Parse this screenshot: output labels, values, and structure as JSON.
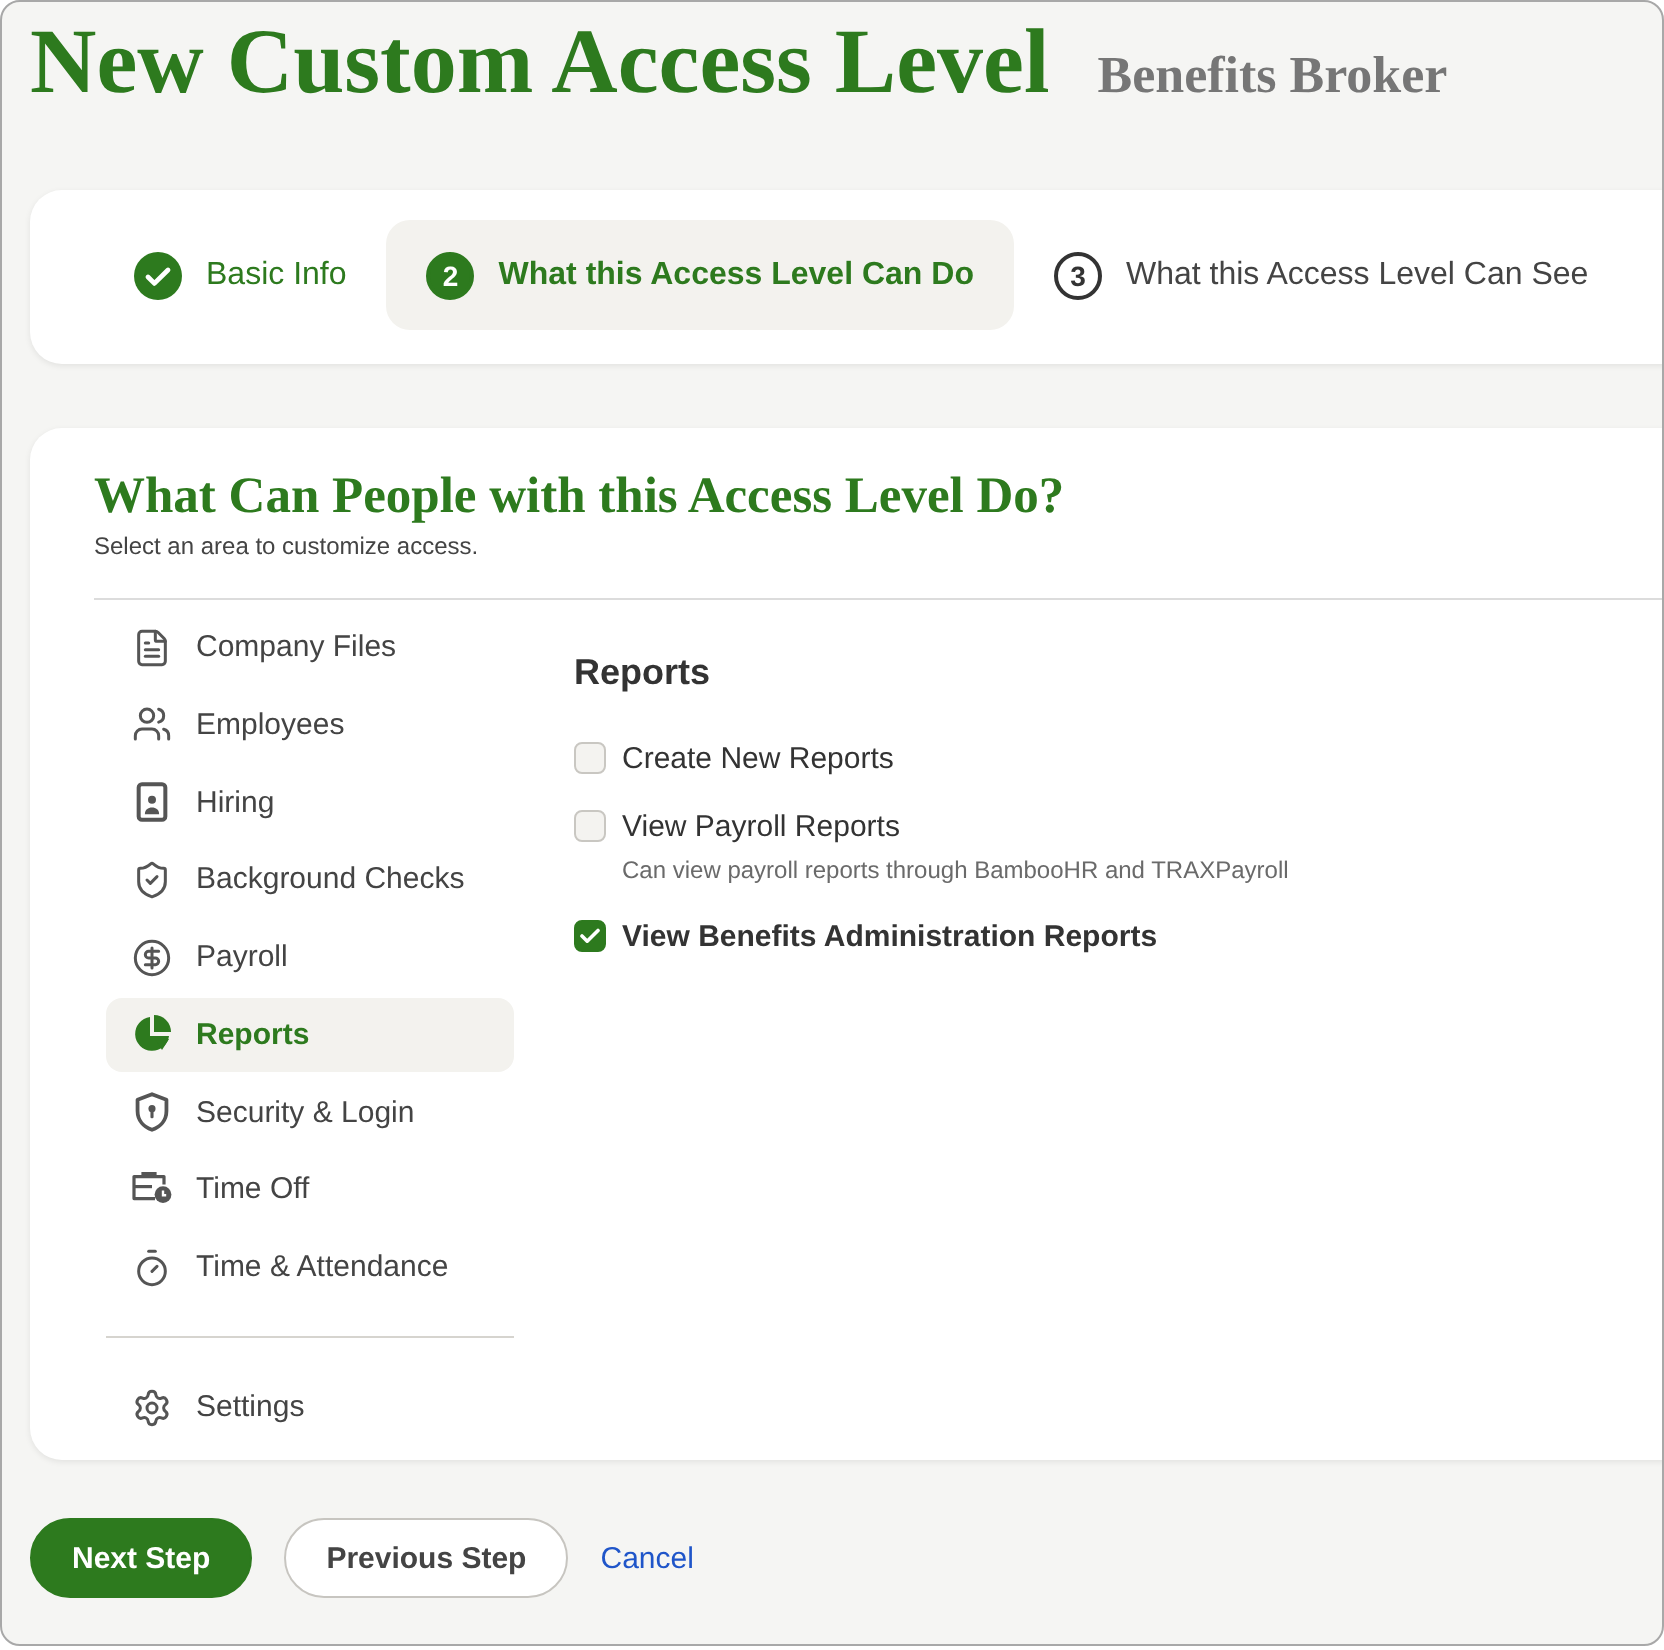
{
  "window": {
    "title": "New Custom Access Level",
    "subtitle": "Benefits Broker"
  },
  "steps": [
    {
      "label": "Basic Info",
      "completed": true,
      "selected": false
    },
    {
      "number": "2",
      "label": "What this Access Level Can Do",
      "completed": false,
      "selected": true
    },
    {
      "number": "3",
      "label": "What this Access Level Can See",
      "completed": false,
      "selected": false
    }
  ],
  "section": {
    "title": "What Can People with this Access Level Do?",
    "subtitle": "Select an area to customize access."
  },
  "sidebar": {
    "items": [
      {
        "label": "Company Files",
        "selected": false
      },
      {
        "label": "Employees",
        "selected": false
      },
      {
        "label": "Hiring",
        "selected": false
      },
      {
        "label": "Background Checks",
        "selected": false
      },
      {
        "label": "Payroll",
        "selected": false
      },
      {
        "label": "Reports",
        "selected": true
      },
      {
        "label": "Security & Login",
        "selected": false
      },
      {
        "label": "Time Off",
        "selected": false
      },
      {
        "label": "Time & Attendance",
        "selected": false
      }
    ],
    "footer_items": [
      {
        "label": "Settings",
        "selected": false
      }
    ]
  },
  "panel": {
    "title": "Reports",
    "permissions": [
      {
        "label": "Create New Reports",
        "checked": false
      },
      {
        "label": "View Payroll Reports",
        "checked": false,
        "description": "Can view payroll reports through BambooHR and TRAXPayroll"
      },
      {
        "label": "View Benefits Administration Reports",
        "checked": true
      }
    ]
  },
  "actions": [
    {
      "label": "Next Step",
      "kind": "primary"
    },
    {
      "label": "Previous Step",
      "kind": "secondary"
    },
    {
      "label": "Cancel",
      "kind": "link"
    }
  ]
}
